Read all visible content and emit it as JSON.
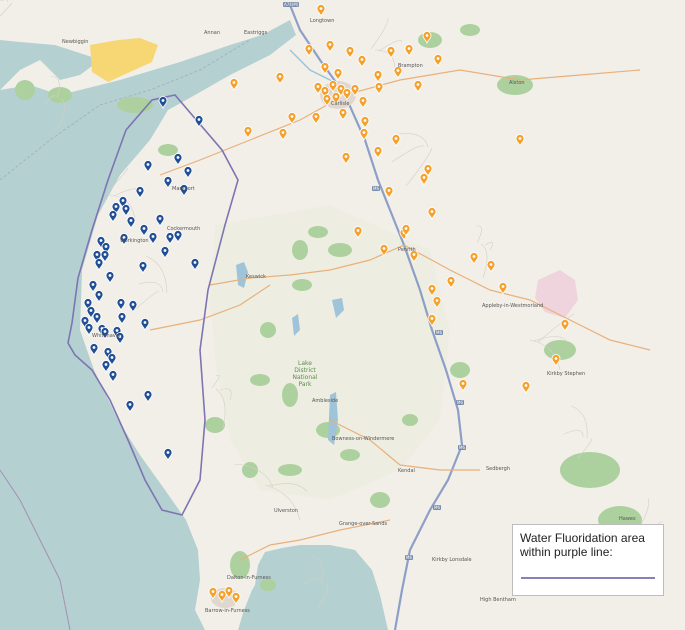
{
  "legend": {
    "title": "Water Fluoridation area within purple line:",
    "line_color": "#8b7fb4"
  },
  "colors": {
    "sea": "#b5d0d0",
    "land": "#f2efe9",
    "fluoridation_boundary": "#7d75b3",
    "blue_marker": "#1f4e96",
    "orange_marker": "#f4a02a",
    "woodland": "#add19e",
    "motorway": "#8d9fc7"
  },
  "places": {
    "newbiggin": "Newbiggin",
    "annan": "Annan",
    "eastriggs": "Eastriggs",
    "longtown": "Longtown",
    "carlisle": "Carlisle",
    "brampton": "Brampton",
    "alston": "Alston",
    "maryport": "Maryport",
    "penrith": "Penrith",
    "keswick": "Keswick",
    "appleby": "Appleby-in-Westmorland",
    "kirkby_stephen": "Kirkby Stephen",
    "ambleside": "Ambleside",
    "kendal": "Kendal",
    "sedbergh": "Sedbergh",
    "ulverston": "Ulverston",
    "grange": "Grange-over-Sands",
    "dalton": "Dalton-in-Furness",
    "barrow": "Barrow-in-Furness",
    "kirkby_lonsdale": "Kirkby Lonsdale",
    "high_bentham": "High Bentham",
    "whitehaven": "Whitehaven",
    "workington": "Workington",
    "cockermouth": "Cockermouth",
    "bowness": "Bowness-on-Windermere",
    "hawes": "Hawes",
    "lake_district": "Lake District National Park"
  },
  "road_shields": [
    "A74(M)",
    "M6",
    "M6",
    "M6",
    "M6",
    "M6",
    "M6"
  ],
  "blue_marker_count": 60,
  "orange_marker_count": 60
}
